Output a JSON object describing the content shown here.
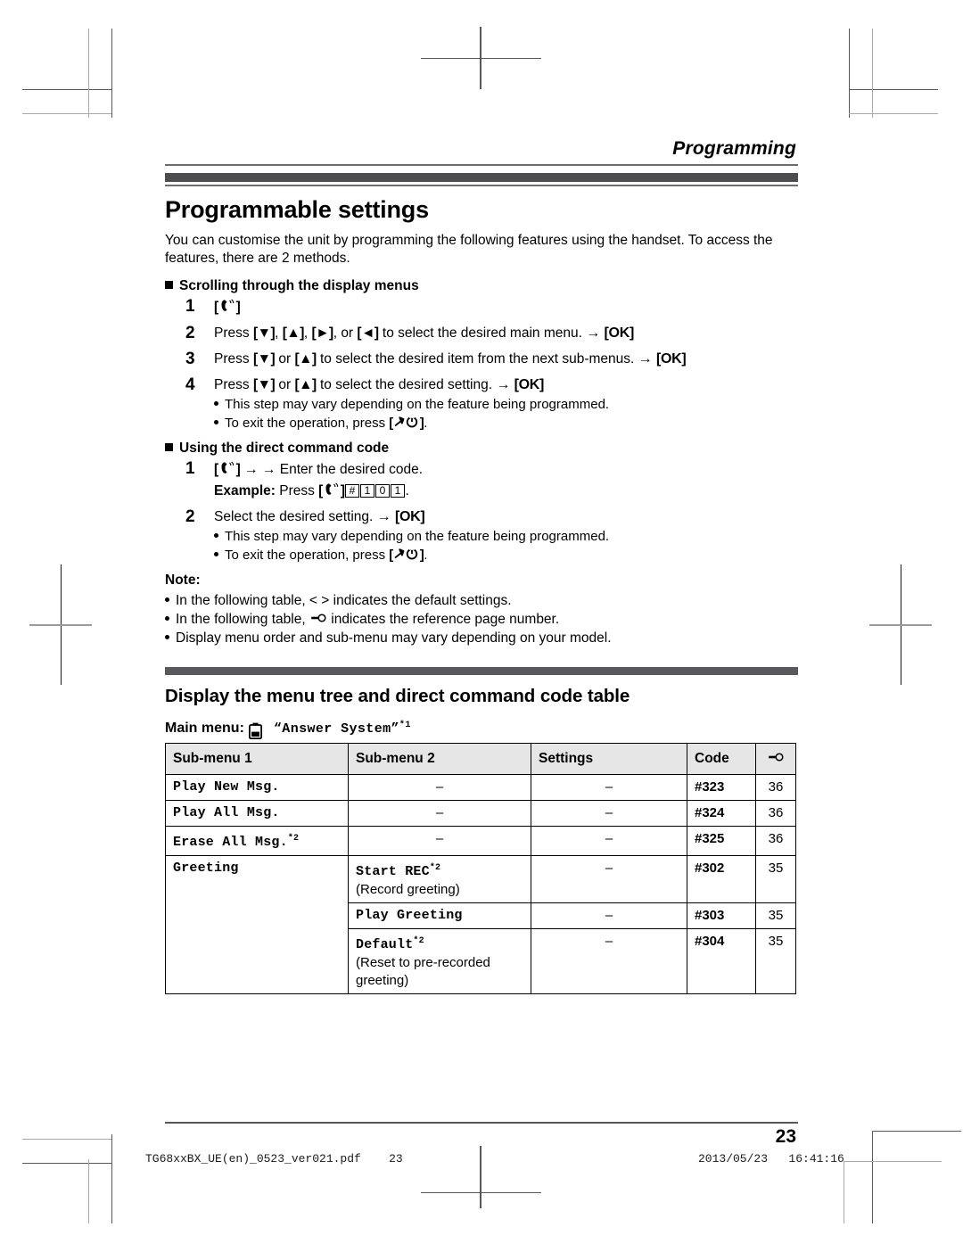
{
  "running_head": "Programming",
  "title": "Programmable settings",
  "intro": "You can customise the unit by programming the following features using the handset. To access the features, there are 2 methods.",
  "section1": {
    "heading": "Scrolling through the display menus",
    "steps": [
      {
        "num": "1",
        "text": ""
      },
      {
        "num": "2",
        "text": "Press [▼], [▲], [►], or [◄] to select the desired main menu. → [OK]"
      },
      {
        "num": "3",
        "text": "Press [▼] or [▲] to select the desired item from the next sub-menus. → [OK]"
      },
      {
        "num": "4",
        "text": "Press [▼] or [▲] to select the desired setting. → [OK]"
      }
    ],
    "bullets": [
      "This step may vary depending on the feature being programmed.",
      "To exit the operation, press"
    ]
  },
  "section2": {
    "heading": "Using the direct command code",
    "step1_text": "→ Enter the desired code.",
    "example_label": "Example:",
    "example_press": "Press",
    "example_keys": [
      "#",
      "1",
      "0",
      "1"
    ],
    "step2_num": "2",
    "step2_text": "Select the desired setting. → [OK]",
    "bullets": [
      "This step may vary depending on the feature being programmed.",
      "To exit the operation, press"
    ]
  },
  "note": {
    "label": "Note:",
    "items": [
      "In the following table, < > indicates the default settings.",
      "In the following table,",
      "Display menu order and sub-menu may vary depending on your model."
    ],
    "item2_tail": "indicates the reference page number."
  },
  "table_section": {
    "heading": "Display the menu tree and direct command code table",
    "main_menu_label": "Main menu:",
    "main_menu_value": "“Answer System”",
    "main_menu_sup": "*1",
    "headers": [
      "Sub-menu 1",
      "Sub-menu 2",
      "Settings",
      "Code",
      "ref-icon"
    ],
    "rows": [
      {
        "sub1": "Play New Msg.",
        "sub1_sup": "",
        "sub2": "–",
        "sub2_sup": "",
        "sub2_note": "",
        "settings": "–",
        "code": "#323",
        "ref": "36",
        "sub1_mono": true,
        "sub2_mono": false
      },
      {
        "sub1": "Play All Msg.",
        "sub1_sup": "",
        "sub2": "–",
        "sub2_sup": "",
        "sub2_note": "",
        "settings": "–",
        "code": "#324",
        "ref": "36",
        "sub1_mono": true,
        "sub2_mono": false
      },
      {
        "sub1": "Erase All Msg.",
        "sub1_sup": "*2",
        "sub2": "–",
        "sub2_sup": "",
        "sub2_note": "",
        "settings": "–",
        "code": "#325",
        "ref": "36",
        "sub1_mono": true,
        "sub2_mono": false
      },
      {
        "sub1": "Greeting",
        "sub1_sup": "",
        "sub2": "Start REC",
        "sub2_sup": "*2",
        "sub2_note": "(Record greeting)",
        "settings": "–",
        "code": "#302",
        "ref": "35",
        "sub1_mono": true,
        "sub2_mono": true
      },
      {
        "sub1": "",
        "sub1_sup": "",
        "sub2": "Play Greeting",
        "sub2_sup": "",
        "sub2_note": "",
        "settings": "–",
        "code": "#303",
        "ref": "35",
        "sub1_mono": true,
        "sub2_mono": true
      },
      {
        "sub1": "",
        "sub1_sup": "",
        "sub2": "Default",
        "sub2_sup": "*2",
        "sub2_note": "(Reset to pre-recorded greeting)",
        "settings": "–",
        "code": "#304",
        "ref": "35",
        "sub1_mono": true,
        "sub2_mono": true
      }
    ]
  },
  "folio": "23",
  "printer_footer": {
    "file": "TG68xxBX_UE(en)_0523_ver021.pdf",
    "page": "23",
    "date": "2013/05/23",
    "time": "16:41:16"
  }
}
